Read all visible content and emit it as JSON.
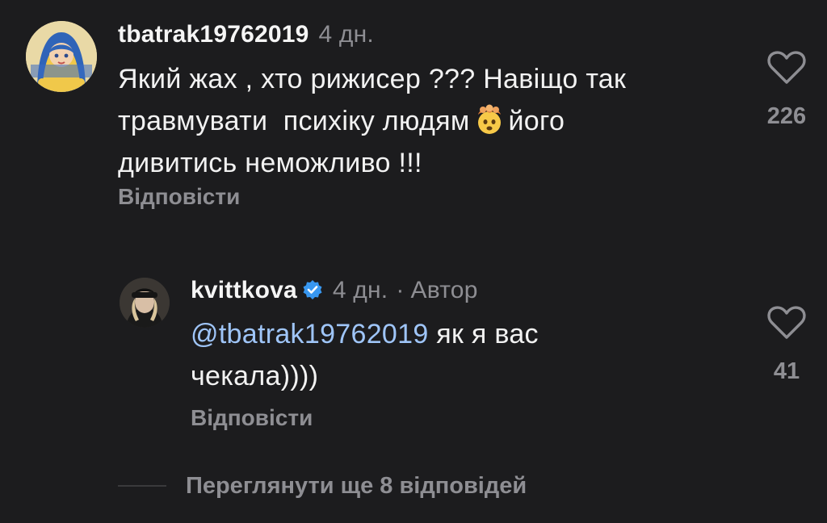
{
  "comment": {
    "username": "tbatrak19762019",
    "time": "4 дн.",
    "text_line1": "Який жах , хто рижисер ??? Навіщо так",
    "text_line2_a": "травмувати  психіку людям",
    "text_line2_b": "його",
    "text_line3": "дивитись неможливо !!!",
    "emoji": "exploding-head-emoji",
    "reply_label": "Відповісти",
    "like_count": "226",
    "like_icon": "heart-icon"
  },
  "reply": {
    "username": "kvittkova",
    "verified_icon": "verified-badge-icon",
    "time": "4 дн.",
    "separator": "·",
    "author_label": "Автор",
    "mention": "@tbatrak19762019",
    "text_line1_rest": "як я вас",
    "text_line2": "чекала))))",
    "reply_label": "Відповісти",
    "like_count": "41",
    "like_icon": "heart-icon"
  },
  "view_more": {
    "label": "Переглянути ще 8 відповідей"
  },
  "colors": {
    "background": "#1c1c1e",
    "text": "#f2f2f2",
    "muted": "#8e8e93",
    "mention": "#9fc5f8",
    "verified": "#3897f0"
  }
}
